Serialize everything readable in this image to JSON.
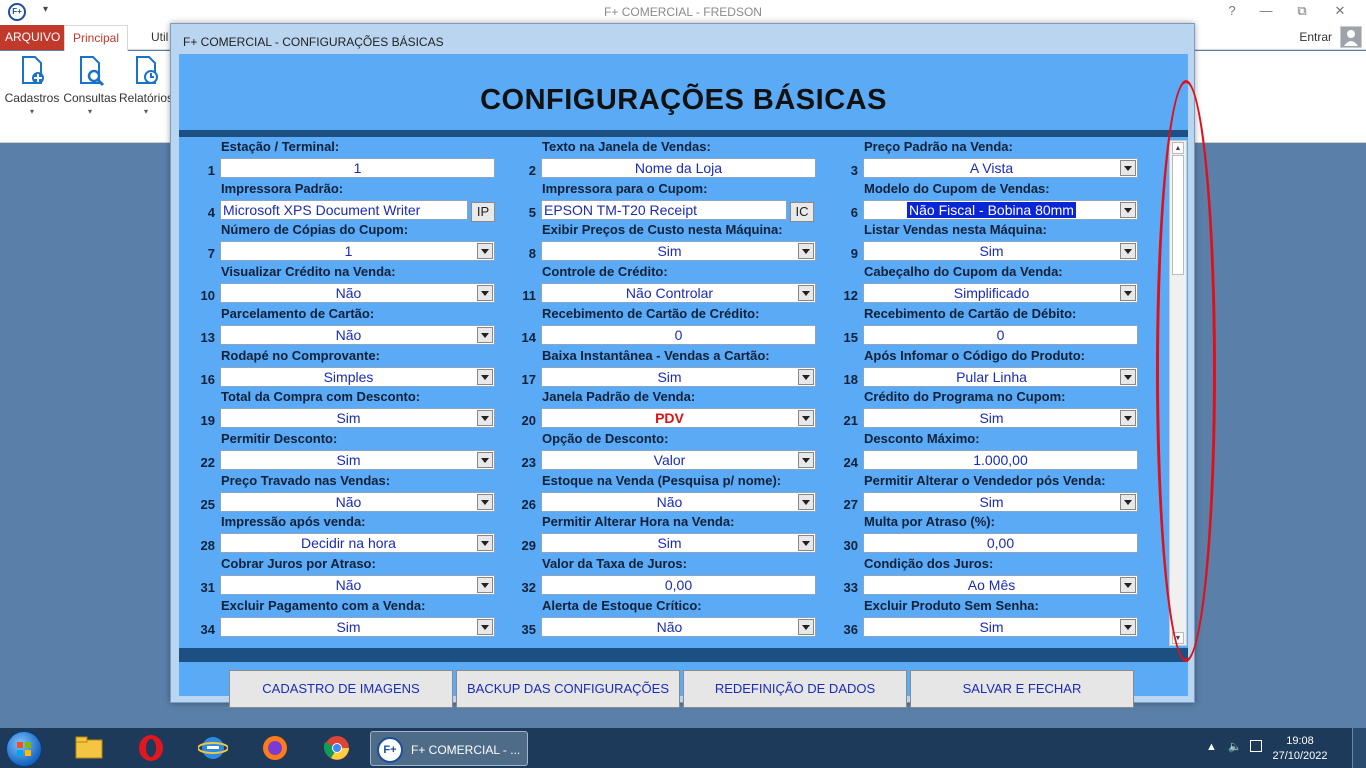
{
  "window": {
    "app_icon_text": "F+",
    "title": "F+ COMERCIAL - FREDSON",
    "controls": [
      "?",
      "—",
      "⧉",
      "✕"
    ]
  },
  "ribbon": {
    "tabs": [
      "ARQUIVO",
      "Principal",
      "Util"
    ],
    "signin": "Entrar",
    "buttons": [
      {
        "label": "Cadastros",
        "icon": "document-add-icon"
      },
      {
        "label": "Consultas",
        "icon": "document-search-icon"
      },
      {
        "label": "Relatórios",
        "icon": "report-icon"
      }
    ]
  },
  "dialog": {
    "title": "F+ COMERCIAL - CONFIGURAÇÕES BÁSICAS",
    "heading": "CONFIGURAÇÕES BÁSICAS",
    "fields": [
      {
        "n": "1",
        "label": "Estação / Terminal:",
        "value": "1",
        "type": "text"
      },
      {
        "n": "2",
        "label": "Texto na Janela de Vendas:",
        "value": "Nome da Loja",
        "type": "text"
      },
      {
        "n": "3",
        "label": "Preço Padrão na Venda:",
        "value": "A Vista",
        "type": "select"
      },
      {
        "n": "4",
        "label": "Impressora Padrão:",
        "value": "Microsoft XPS Document Writer",
        "type": "printer",
        "button": "IP"
      },
      {
        "n": "5",
        "label": "Impressora para o Cupom:",
        "value": "EPSON TM-T20 Receipt",
        "type": "printer",
        "button": "IC"
      },
      {
        "n": "6",
        "label": "Modelo do Cupom de Vendas:",
        "value": "Não Fiscal - Bobina 80mm",
        "type": "select",
        "selected": true
      },
      {
        "n": "7",
        "label": "Número de Cópias do Cupom:",
        "value": "1",
        "type": "select"
      },
      {
        "n": "8",
        "label": "Exibir Preços de Custo nesta Máquina:",
        "value": "Sim",
        "type": "select"
      },
      {
        "n": "9",
        "label": "Listar Vendas nesta Máquina:",
        "value": "Sim",
        "type": "select"
      },
      {
        "n": "10",
        "label": "Visualizar Crédito na Venda:",
        "value": "Não",
        "type": "select"
      },
      {
        "n": "11",
        "label": "Controle de Crédito:",
        "value": "Não Controlar",
        "type": "select"
      },
      {
        "n": "12",
        "label": "Cabeçalho do Cupom da Venda:",
        "value": "Simplificado",
        "type": "select"
      },
      {
        "n": "13",
        "label": "Parcelamento de Cartão:",
        "value": "Não",
        "type": "select"
      },
      {
        "n": "14",
        "label": "Recebimento de Cartão de Crédito:",
        "value": "0",
        "type": "text"
      },
      {
        "n": "15",
        "label": "Recebimento de Cartão de Débito:",
        "value": "0",
        "type": "text"
      },
      {
        "n": "16",
        "label": "Rodapé no Comprovante:",
        "value": "Simples",
        "type": "select"
      },
      {
        "n": "17",
        "label": "Baixa Instantânea - Vendas a Cartão:",
        "value": "Sim",
        "type": "select"
      },
      {
        "n": "18",
        "label": "Após Infomar o Código do Produto:",
        "value": "Pular Linha",
        "type": "select"
      },
      {
        "n": "19",
        "label": "Total da Compra com Desconto:",
        "value": "Sim",
        "type": "select"
      },
      {
        "n": "20",
        "label": "Janela Padrão de Venda:",
        "value": "PDV",
        "type": "select",
        "red": true
      },
      {
        "n": "21",
        "label": "Crédito do Programa no Cupom:",
        "value": "Sim",
        "type": "select"
      },
      {
        "n": "22",
        "label": "Permitir Desconto:",
        "value": "Sim",
        "type": "select"
      },
      {
        "n": "23",
        "label": "Opção de Desconto:",
        "value": "Valor",
        "type": "select"
      },
      {
        "n": "24",
        "label": "Desconto Máximo:",
        "value": "1.000,00",
        "type": "text"
      },
      {
        "n": "25",
        "label": "Preço Travado nas Vendas:",
        "value": "Não",
        "type": "select"
      },
      {
        "n": "26",
        "label": "Estoque na Venda (Pesquisa p/ nome):",
        "value": "Não",
        "type": "select"
      },
      {
        "n": "27",
        "label": "Permitir Alterar o Vendedor pós Venda:",
        "value": "Sim",
        "type": "select"
      },
      {
        "n": "28",
        "label": "Impressão após venda:",
        "value": "Decidir na hora",
        "type": "select"
      },
      {
        "n": "29",
        "label": "Permitir Alterar Hora na Venda:",
        "value": "Sim",
        "type": "select"
      },
      {
        "n": "30",
        "label": "Multa por Atraso (%):",
        "value": "0,00",
        "type": "text"
      },
      {
        "n": "31",
        "label": "Cobrar Juros por Atraso:",
        "value": "Não",
        "type": "select"
      },
      {
        "n": "32",
        "label": "Valor da Taxa de Juros:",
        "value": "0,00",
        "type": "text"
      },
      {
        "n": "33",
        "label": "Condição dos Juros:",
        "value": "Ao Mês",
        "type": "select"
      },
      {
        "n": "34",
        "label": "Excluir Pagamento com a Venda:",
        "value": "Sim",
        "type": "select"
      },
      {
        "n": "35",
        "label": "Alerta de Estoque Crítico:",
        "value": "Não",
        "type": "select"
      },
      {
        "n": "36",
        "label": "Excluir Produto Sem Senha:",
        "value": "Sim",
        "type": "select"
      }
    ],
    "buttons": [
      "CADASTRO DE IMAGENS",
      "BACKUP DAS CONFIGURAÇÕES",
      "REDEFINIÇÃO DE DADOS",
      "SALVAR E FECHAR"
    ]
  },
  "taskbar": {
    "pinned": [
      "windows-explorer-icon",
      "opera-icon",
      "internet-explorer-icon",
      "firefox-icon",
      "chrome-icon"
    ],
    "active_app": {
      "icon_text": "F+",
      "label": "F+ COMERCIAL - ..."
    },
    "time": "19:08",
    "date": "27/10/2022"
  },
  "colors": {
    "panel": "#5aaaf5",
    "dark_bar": "#1c4f82",
    "field_text": "#1a2bb8",
    "accent_red": "#c0392b",
    "annotation": "#e0101a"
  }
}
